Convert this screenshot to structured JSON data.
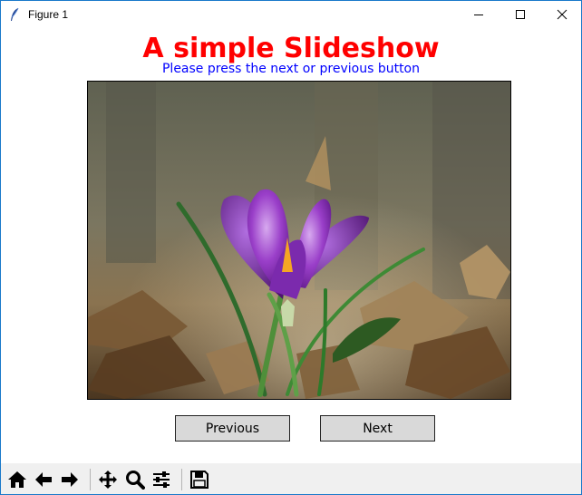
{
  "window": {
    "title": "Figure 1",
    "controls": [
      "minimize-icon",
      "maximize-icon",
      "close-icon"
    ]
  },
  "figure": {
    "title": "A simple Slideshow",
    "subtitle": "Please press the next or previous button",
    "title_color": "#ff0000",
    "subtitle_color": "#0000ff",
    "image_subject": "purple crocus flower among dry autumn leaves"
  },
  "buttons": {
    "previous": "Previous",
    "next": "Next"
  },
  "toolbar": {
    "items": [
      "home-icon",
      "back-arrow-icon",
      "forward-arrow-icon",
      "pan-icon",
      "zoom-icon",
      "configure-subplots-icon",
      "save-icon"
    ]
  }
}
